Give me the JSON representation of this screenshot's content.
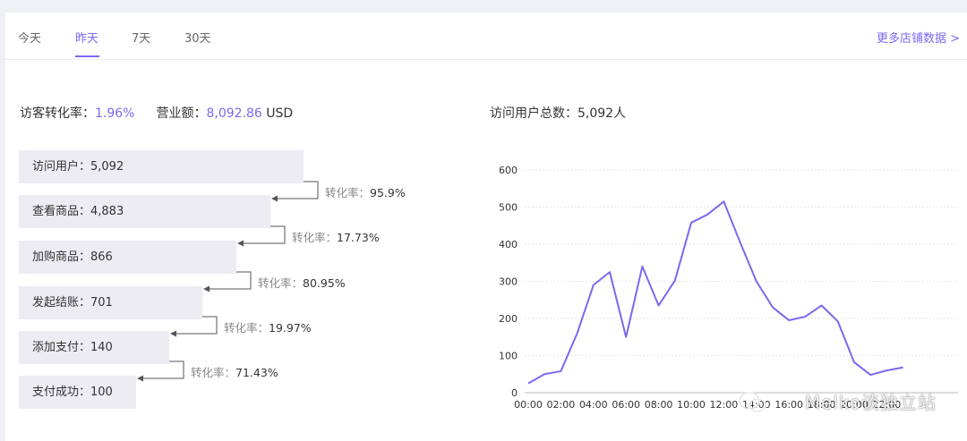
{
  "tabs": [
    {
      "label": "今天"
    },
    {
      "label": "昨天"
    },
    {
      "label": "7天"
    },
    {
      "label": "30天"
    }
  ],
  "active_tab": 1,
  "more_link": "更多店铺数据 >",
  "metrics": {
    "conversion_label": "访客转化率：",
    "conversion_value": "1.96%",
    "revenue_label": "营业额：",
    "revenue_value": "8,092.86",
    "revenue_unit": " USD"
  },
  "visitors_total": "访问用户总数：5,092人",
  "funnel": {
    "steps": [
      {
        "label": "访问用户：5,092",
        "value": 5092
      },
      {
        "label": "查看商品：4,883",
        "value": 4883
      },
      {
        "label": "加购商品：866",
        "value": 866
      },
      {
        "label": "发起结账：701",
        "value": 701
      },
      {
        "label": "添加支付：140",
        "value": 140
      },
      {
        "label": "支付成功：100",
        "value": 100
      }
    ],
    "conversions": [
      {
        "label": "转化率：",
        "value": "95.9%"
      },
      {
        "label": "转化率：",
        "value": "17.73%"
      },
      {
        "label": "转化率：",
        "value": "80.95%"
      },
      {
        "label": "转化率：",
        "value": "19.97%"
      },
      {
        "label": "转化率：",
        "value": "71.43%"
      }
    ]
  },
  "chart_data": {
    "type": "line",
    "title": "",
    "xlabel": "",
    "ylabel": "",
    "ylim": [
      0,
      600
    ],
    "yticks": [
      "0",
      "100",
      "200",
      "300",
      "400",
      "500",
      "600"
    ],
    "xticks": [
      "00:00",
      "02:00",
      "04:00",
      "06:00",
      "08:00",
      "10:00",
      "12:00",
      "14:00",
      "16:00",
      "18:00",
      "20:00",
      "22:00"
    ],
    "x": [
      "00:00",
      "01:00",
      "02:00",
      "03:00",
      "04:00",
      "05:00",
      "06:00",
      "07:00",
      "08:00",
      "09:00",
      "10:00",
      "11:00",
      "12:00",
      "13:00",
      "14:00",
      "15:00",
      "16:00",
      "17:00",
      "18:00",
      "19:00",
      "20:00",
      "21:00",
      "22:00",
      "23:00"
    ],
    "series": [
      {
        "values": [
          25,
          50,
          58,
          160,
          290,
          325,
          150,
          340,
          235,
          302,
          458,
          480,
          515,
          405,
          300,
          230,
          195,
          205,
          235,
          192,
          82,
          48,
          60,
          68
        ]
      }
    ],
    "grid": true,
    "line_color": "#7b68ee"
  },
  "watermark": "Melko谈独立站"
}
